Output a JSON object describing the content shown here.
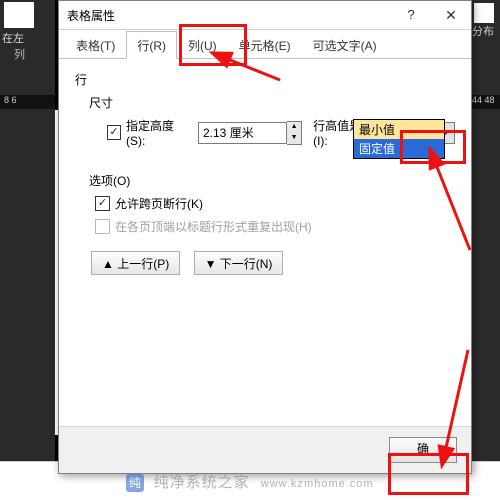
{
  "bg": {
    "insert_left": "在左",
    "col": "列",
    "ruler": "8   6",
    "right_label": "分布",
    "right_ruler": "44  48"
  },
  "dialog": {
    "title": "表格属性",
    "help": "?",
    "close": "✕",
    "tabs": {
      "table": "表格(T)",
      "row": "行(R)",
      "column": "列(U)",
      "cell": "单元格(E)",
      "alt": "可选文字(A)"
    },
    "section_row": "行",
    "section_size": "尺寸",
    "spec_height_label": "指定高度(S):",
    "height_value": "2.13 厘米",
    "height_is_label": "行高值是(I):",
    "combo_value": "固定值",
    "dropdown": {
      "opt_min": "最小值",
      "opt_fixed": "固定值"
    },
    "section_options": "选项(O)",
    "allow_break": "允许跨页断行(K)",
    "repeat_header": "在各页顶端以标题行形式重复出现(H)",
    "prev_row": "▲ 上一行(P)",
    "next_row": "▼ 下一行(N)",
    "ok": "确"
  },
  "watermark": {
    "text": "纯净系统之家",
    "url": "www.kzmhome.com"
  }
}
